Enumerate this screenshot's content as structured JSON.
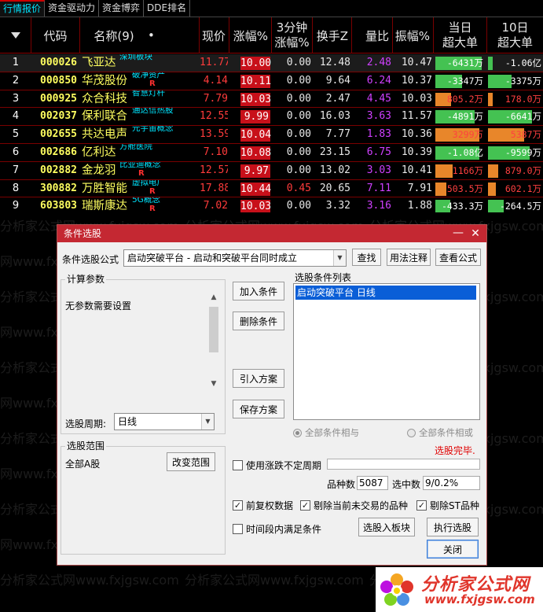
{
  "tabs": [
    "行情报价",
    "资金驱动力",
    "资金博弈",
    "DDE排名"
  ],
  "headers": {
    "menu_icon": "triangle-down-icon",
    "code": "代码",
    "name": "名称(9)",
    "name_dot": "•",
    "price": "现价",
    "chg": "涨幅%",
    "chg3_l1": "3分钟",
    "chg3_l2": "涨幅%",
    "turnover": "换手Z",
    "volratio": "量比",
    "amp": "振幅%",
    "big1_l1": "当日",
    "big1_l2": "超大单",
    "big2_l1": "10日",
    "big2_l2": "超大单"
  },
  "rows": [
    {
      "idx": "1",
      "code": "000026",
      "name": "飞亚达",
      "tag": "深圳板块",
      "rk": "",
      "price": "11.77",
      "chg": "10.00",
      "chg3": "0.00",
      "turnover": "12.48",
      "volratio": "2.48",
      "amp": "10.47",
      "big1": "-6431万",
      "big1_frac": 0.95,
      "big2": "-1.06亿",
      "big2_frac": 0.05
    },
    {
      "idx": "2",
      "code": "000850",
      "name": "华茂股份",
      "tag": "破净资产",
      "rk": "R",
      "price": "4.14",
      "chg": "10.11",
      "chg3": "0.00",
      "turnover": "9.64",
      "volratio": "6.24",
      "amp": "10.37",
      "big1": "-3347万",
      "big1_frac": 0.55,
      "big2": "-3375万",
      "big2_frac": 0.45
    },
    {
      "idx": "3",
      "code": "000925",
      "name": "众合科技",
      "tag": "智慧灯杆",
      "rk": "",
      "price": "7.79",
      "chg": "10.03",
      "chg3": "0.00",
      "turnover": "2.47",
      "volratio": "4.45",
      "amp": "10.03",
      "big1": "805.2万",
      "big1_frac": 0.33,
      "big2": "178.0万",
      "big2_frac": 0.05
    },
    {
      "idx": "4",
      "code": "002037",
      "name": "保利联合",
      "tag": "通达信热股",
      "rk": "",
      "price": "12.55",
      "chg": "9.99",
      "chg3": "0.00",
      "turnover": "16.03",
      "volratio": "3.63",
      "amp": "11.57",
      "big1": "-4891万",
      "big1_frac": 0.8,
      "big2": "-6641万",
      "big2_frac": 0.85
    },
    {
      "idx": "5",
      "code": "002655",
      "name": "共达电声",
      "tag": "元宇宙概念",
      "rk": "",
      "price": "13.59",
      "chg": "10.04",
      "chg3": "0.00",
      "turnover": "7.77",
      "volratio": "1.83",
      "amp": "10.36",
      "big1": "3299万",
      "big1_frac": 0.9,
      "big2": "5387万",
      "big2_frac": 0.7
    },
    {
      "idx": "6",
      "code": "002686",
      "name": "亿利达",
      "tag": "方舱医院",
      "rk": "",
      "price": "7.10",
      "chg": "10.08",
      "chg3": "0.00",
      "turnover": "23.15",
      "volratio": "6.75",
      "amp": "10.39",
      "big1": "-1.08亿",
      "big1_frac": 0.9,
      "big2": "-9599万",
      "big2_frac": 0.8
    },
    {
      "idx": "7",
      "code": "002882",
      "name": "金龙羽",
      "tag": "比亚迪概念",
      "rk": "R",
      "price": "12.57",
      "chg": "9.97",
      "chg3": "0.00",
      "turnover": "13.02",
      "volratio": "3.03",
      "amp": "10.41",
      "big1": "1166万",
      "big1_frac": 0.35,
      "big2": "879.0万",
      "big2_frac": 0.2
    },
    {
      "idx": "8",
      "code": "300882",
      "name": "万胜智能",
      "tag": "虚拟电厂",
      "rk": "R",
      "price": "17.88",
      "chg": "10.44",
      "chg3": "0.45",
      "turnover": "20.65",
      "volratio": "7.11",
      "amp": "7.91",
      "big1": "503.5万",
      "big1_frac": 0.22,
      "big2": "602.1万",
      "big2_frac": 0.15
    },
    {
      "idx": "9",
      "code": "603803",
      "name": "瑞斯康达",
      "tag": "5G概念",
      "rk": "R",
      "price": "7.02",
      "chg": "10.03",
      "chg3": "0.00",
      "turnover": "3.32",
      "volratio": "3.16",
      "amp": "1.88",
      "big1": "-433.3万",
      "big1_frac": 0.3,
      "big2": "-264.5万",
      "big2_frac": 0.3
    }
  ],
  "colors": {
    "up": "#ff3b3b",
    "down": "#3bd64a",
    "code": "#ffff60",
    "tag": "#00e5ff",
    "volratio": "#d040ff",
    "bar_neg": "#44c252",
    "bar_pos": "#e8862a"
  },
  "watermark": "分析家公式网www.fxjgsw.com",
  "dialog": {
    "title": "条件选股",
    "formula_label": "条件选股公式",
    "formula_value": "启动突破平台 - 启动和突破平台同时成立",
    "find_btn": "查找",
    "usage_btn": "用法注释",
    "view_btn": "查看公式",
    "params_title": "计算参数",
    "params_text": "无参数需要设置",
    "period_label": "选股周期:",
    "period_value": "日线",
    "add_btn": "加入条件",
    "del_btn": "删除条件",
    "import_btn": "引入方案",
    "save_btn": "保存方案",
    "list_title": "选股条件列表",
    "list_item": "启动突破平台  日线",
    "radio_and": "全部条件相与",
    "radio_or": "全部条件相或",
    "status": "选股完毕.",
    "range_title": "选股范围",
    "range_value": "全部A股",
    "change_range_btn": "改变范围",
    "use_period_chk": "使用涨跌不定周期",
    "count_label": "品种数",
    "count_value": "5087",
    "selected_label": "选中数",
    "selected_value": "9/0.2%",
    "prev_adj_chk": "前复权数据",
    "exclude_untraded_chk": "剔除当前未交易的品种",
    "exclude_st_chk": "剔除ST品种",
    "time_range_chk": "时间段内满足条件",
    "to_board_btn": "选股入板块",
    "run_btn": "执行选股",
    "close_btn": "关闭",
    "checked_mark": "✓"
  },
  "logo": {
    "name": "分析家公式网",
    "url": "www.fxjgsw.com"
  }
}
